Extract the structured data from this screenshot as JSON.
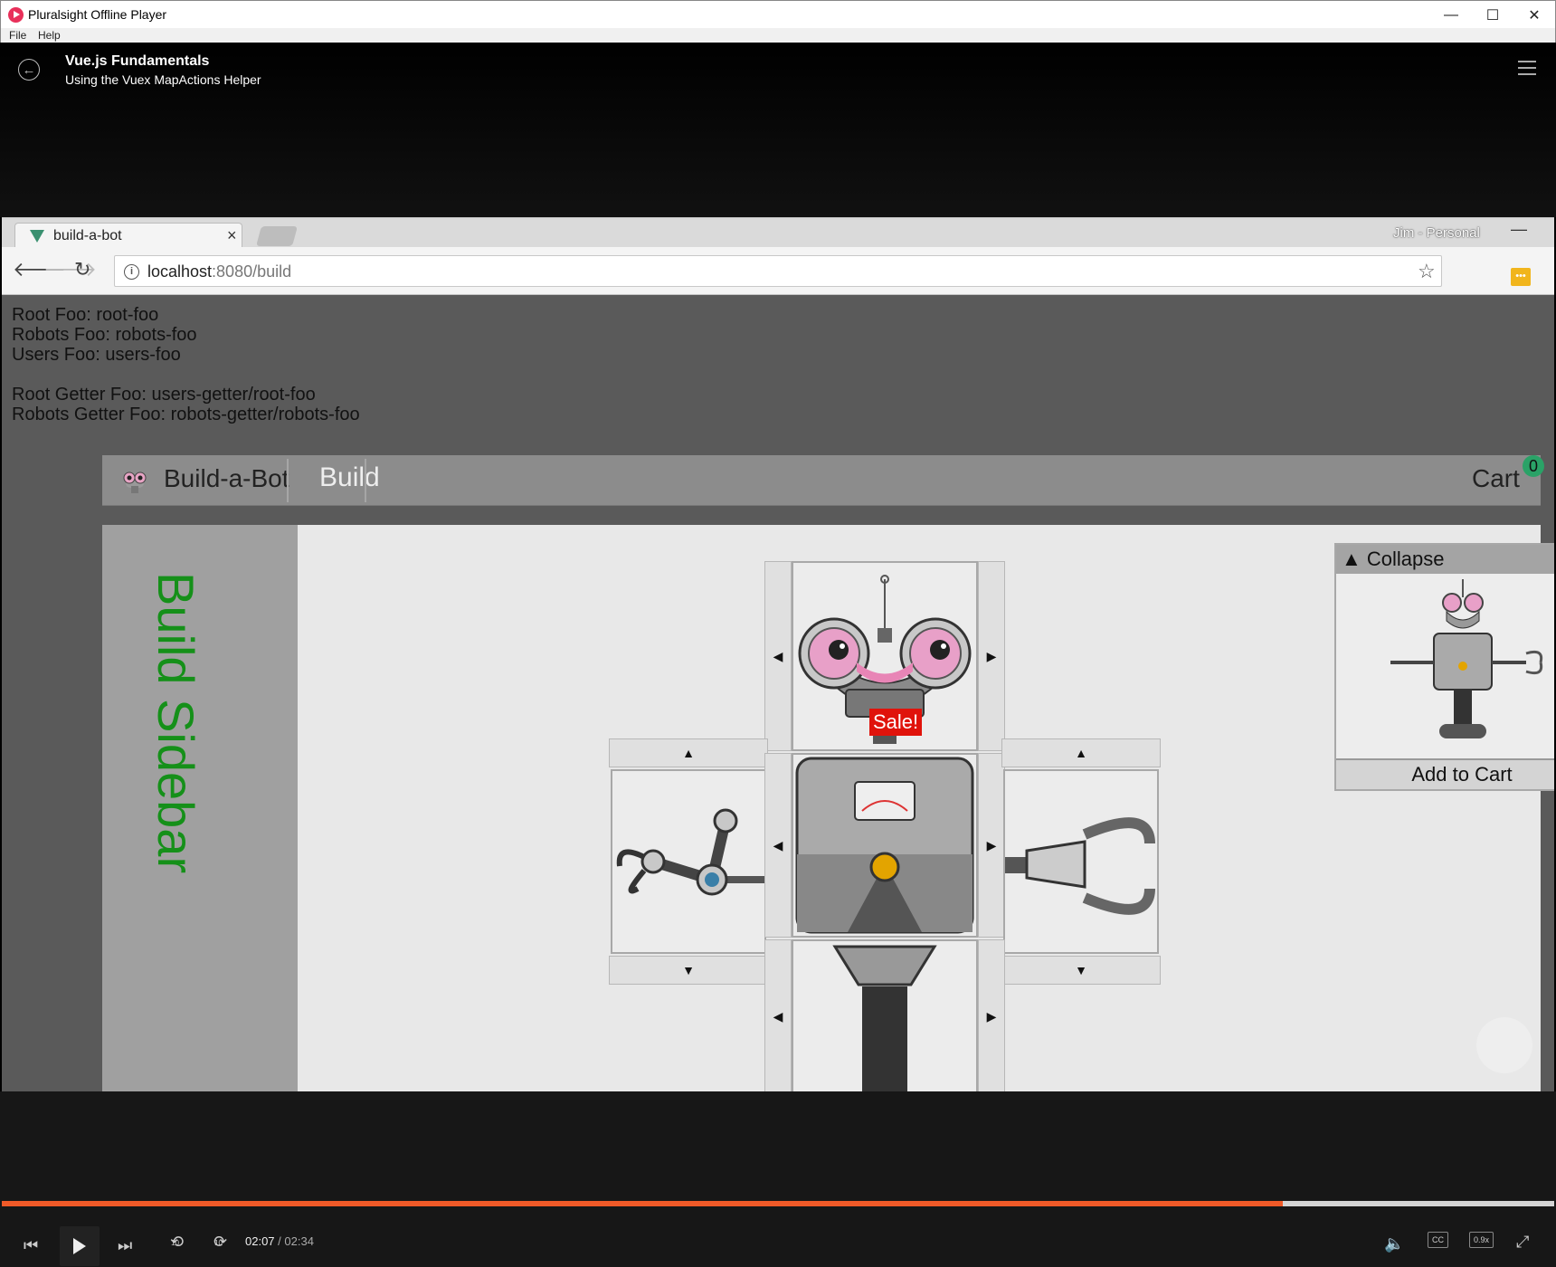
{
  "window": {
    "title": "Pluralsight Offline Player",
    "minimize": "—",
    "maximize": "☐",
    "close": "✕"
  },
  "menu": [
    {
      "label": "File"
    },
    {
      "label": "Help"
    }
  ],
  "player": {
    "course_title": "Vue.js Fundamentals",
    "clip_title": "Using the Vuex MapActions Helper",
    "current_time": "02:07",
    "separator": "/",
    "total_time": "02:34",
    "progress_fraction": 0.825,
    "speed": "0.9x",
    "cc": "CC",
    "rewind_label": "10",
    "forward_label": "10",
    "accent_color": "#f05a28"
  },
  "browser": {
    "tab_title": "build-a-bot",
    "tab_close": "×",
    "profile": "Jim - Personal",
    "url_host": "localhost",
    "url_path": ":8080/build",
    "info_icon": "i"
  },
  "page": {
    "debug_lines": [
      "Root Foo: root-foo",
      "Robots Foo: robots-foo",
      "Users Foo: users-foo",
      "",
      "Root Getter Foo: users-getter/root-foo",
      "Robots Getter Foo: robots-getter/robots-foo"
    ],
    "nav": {
      "brand": "Build-a-Bot",
      "build": "Build",
      "cart": "Cart",
      "cart_count": "0"
    },
    "sidebar_text": "Build Sidebar",
    "sale_label": "Sale!",
    "preview": {
      "collapse_label": "▲ Collapse",
      "add_to_cart": "Add to Cart"
    },
    "arrows": {
      "left": "◀",
      "right": "▶",
      "up": "▲",
      "down": "▼"
    }
  }
}
